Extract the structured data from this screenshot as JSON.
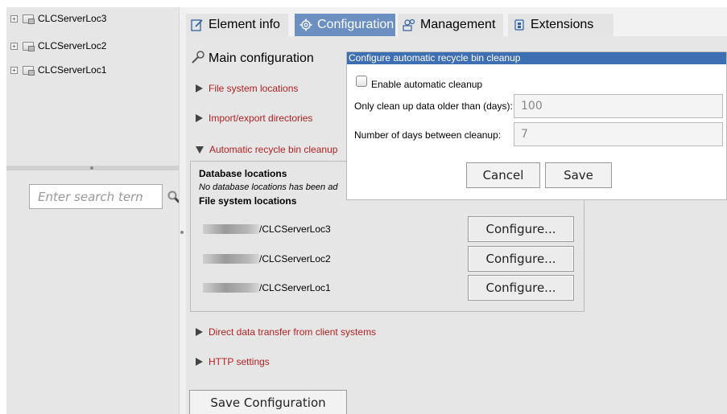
{
  "tree": {
    "items": [
      {
        "label": "CLCServerLoc3"
      },
      {
        "label": "CLCServerLoc2"
      },
      {
        "label": "CLCServerLoc1"
      }
    ]
  },
  "search": {
    "placeholder": "Enter search term"
  },
  "tabs": [
    {
      "label": "Element info",
      "icon": "edit-icon"
    },
    {
      "label": "Configuration",
      "icon": "gear-icon",
      "active": true
    },
    {
      "label": "Management",
      "icon": "people-icon"
    },
    {
      "label": "Extensions",
      "icon": "plugin-icon"
    }
  ],
  "main": {
    "title": "Main configuration",
    "sections": {
      "file_system_locations": "File system locations",
      "import_export": "Import/export directories",
      "recycle_bin": "Automatic recycle bin cleanup",
      "direct_transfer": "Direct data transfer from client systems",
      "http_settings": "HTTP settings"
    },
    "recycle": {
      "db_heading": "Database locations",
      "db_empty": "No database locations has been ad",
      "fs_heading": "File system locations",
      "paths": [
        {
          "suffix": "/CLCServerLoc3",
          "button": "Configure..."
        },
        {
          "suffix": "/CLCServerLoc2",
          "button": "Configure..."
        },
        {
          "suffix": "/CLCServerLoc1",
          "button": "Configure..."
        }
      ]
    },
    "save_label": "Save Configuration"
  },
  "dialog": {
    "title": "Configure automatic recycle bin cleanup",
    "enable_label": "Enable automatic cleanup",
    "enable_checked": false,
    "older_label": "Only clean up data older than (days):",
    "older_value": "100",
    "interval_label": "Number of days between cleanup:",
    "interval_value": "7",
    "cancel_label": "Cancel",
    "save_label": "Save"
  },
  "colors": {
    "active_tab": "#6a8fc0",
    "dialog_title_bar": "#3f6fb3",
    "section_link": "#b22222",
    "panel_bg": "#e6e6e6"
  }
}
